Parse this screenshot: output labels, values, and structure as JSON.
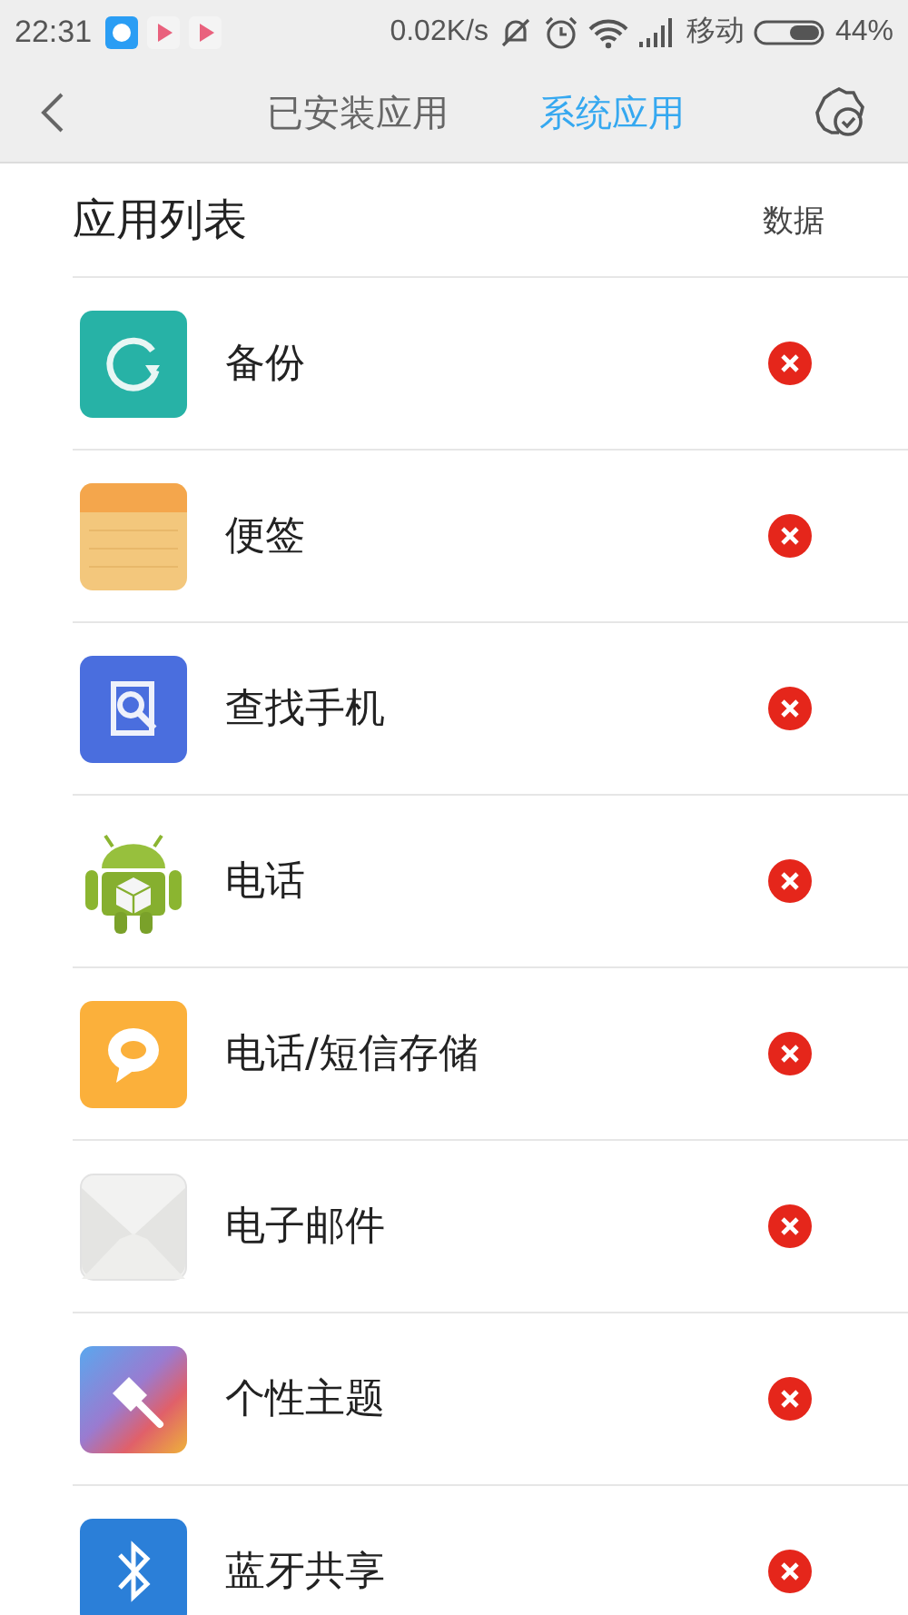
{
  "status_bar": {
    "time": "22:31",
    "speed": "0.02K/s",
    "carrier": "移动",
    "battery": "44%"
  },
  "nav": {
    "tabs": [
      {
        "label": "已安装应用",
        "selected": false
      },
      {
        "label": "系统应用",
        "selected": true
      }
    ]
  },
  "list": {
    "title": "应用列表",
    "column_label": "数据",
    "apps": [
      {
        "name": "备份",
        "kind": "backup"
      },
      {
        "name": "便签",
        "kind": "notes"
      },
      {
        "name": "查找手机",
        "kind": "find"
      },
      {
        "name": "电话",
        "kind": "android"
      },
      {
        "name": "电话/短信存储",
        "kind": "message"
      },
      {
        "name": "电子邮件",
        "kind": "mail"
      },
      {
        "name": "个性主题",
        "kind": "theme"
      },
      {
        "name": "蓝牙共享",
        "kind": "bluetooth"
      }
    ]
  }
}
